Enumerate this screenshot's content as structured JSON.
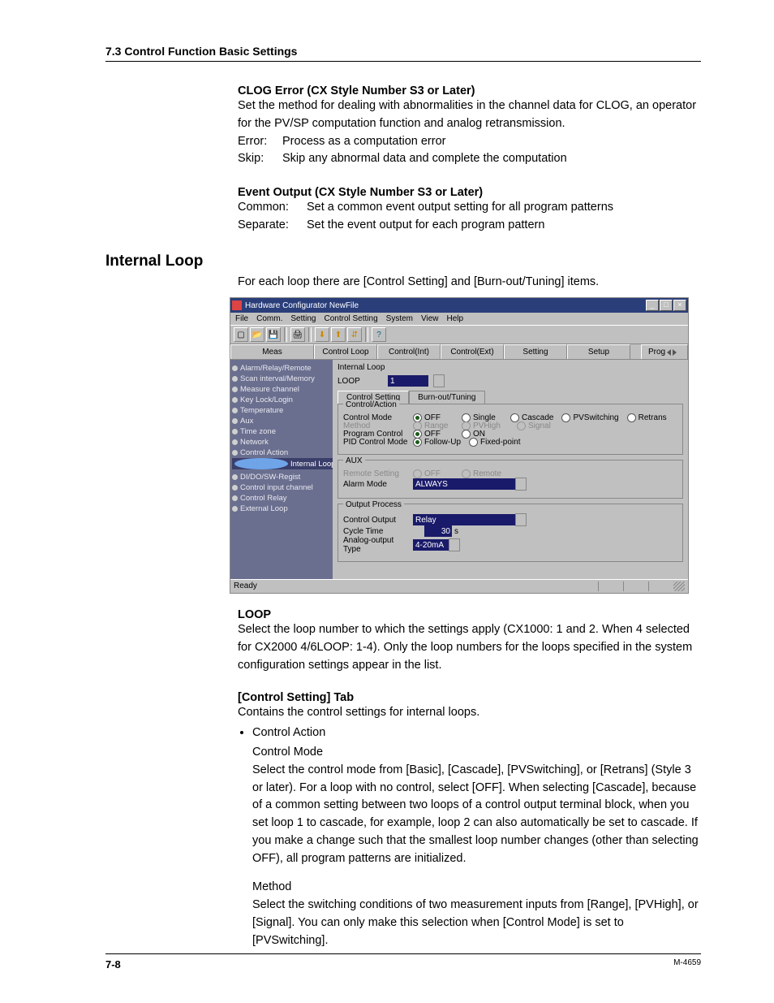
{
  "header": "7.3  Control Function Basic Settings",
  "clog": {
    "heading": "CLOG Error (CX Style Number S3 or Later)",
    "intro": "Set the method for dealing with abnormalities in the channel data for CLOG, an operator for the PV/SP computation function and analog retransmission.",
    "rows": [
      {
        "k": "Error:",
        "v": "Process as a computation error"
      },
      {
        "k": "Skip:",
        "v": "Skip any abnormal data and complete the computation"
      }
    ]
  },
  "event": {
    "heading": "Event Output (CX Style Number S3 or Later)",
    "rows": [
      {
        "k": "Common:",
        "v": "Set a common event output setting for all program patterns"
      },
      {
        "k": "Separate:",
        "v": "Set the event output for each program pattern"
      }
    ]
  },
  "internal_heading": "Internal Loop",
  "internal_intro": "For each loop there are [Control Setting] and [Burn-out/Tuning] items.",
  "shot": {
    "title": "Hardware Configurator NewFile",
    "menus": [
      "File",
      "Comm.",
      "Setting",
      "Control Setting",
      "System",
      "View",
      "Help"
    ],
    "tabs": [
      "Meas",
      "Control Loop",
      "Control(Int)",
      "Control(Ext)",
      "Setting",
      "Setup"
    ],
    "tab_scroll_label": "Prog",
    "tree": [
      "Alarm/Relay/Remote",
      "Scan interval/Memory",
      "Measure channel",
      "Key Lock/Login",
      "Temperature",
      "Aux",
      "Time zone",
      "Network",
      "Control Action",
      "Internal Loop",
      "DI/DO/SW-Regist",
      "Control input channel",
      "Control Relay",
      "External Loop"
    ],
    "tree_selected_index": 9,
    "form_title": "Internal Loop",
    "loop_label": "LOOP",
    "loop_value": "1",
    "subtabs": [
      "Control Setting",
      "Burn-out/Tuning"
    ],
    "group_control": {
      "label": "Control/Action",
      "rows": {
        "control_mode": {
          "label": "Control Mode",
          "opts": [
            "OFF",
            "Single",
            "Cascade",
            "PVSwitching",
            "Retrans"
          ],
          "sel": 0
        },
        "method": {
          "label": "Method",
          "opts": [
            "Range",
            "PVHigh",
            "Signal"
          ],
          "disabled": true
        },
        "program_control": {
          "label": "Program Control",
          "opts": [
            "OFF",
            "ON"
          ],
          "sel": 0
        },
        "pid_mode": {
          "label": "PID Control Mode",
          "opts": [
            "Follow-Up",
            "Fixed-point"
          ],
          "sel": 0
        }
      }
    },
    "group_aux": {
      "label": "AUX",
      "remote": {
        "label": "Remote Setting",
        "opts": [
          "OFF",
          "Remote"
        ],
        "disabled": true
      },
      "alarm": {
        "label": "Alarm Mode",
        "value": "ALWAYS"
      }
    },
    "group_out": {
      "label": "Output Process",
      "control_output": {
        "label": "Control Output",
        "value": "Relay"
      },
      "cycle": {
        "label": "Cycle Time",
        "value": "30",
        "unit": "s"
      },
      "analog": {
        "label": "Analog-output Type",
        "value": "4-20mA"
      }
    },
    "status": "Ready"
  },
  "loop": {
    "heading": "LOOP",
    "text": "Select the loop number to which the settings apply (CX1000: 1 and 2. When 4 selected for CX2000 4/6LOOP: 1-4). Only the loop numbers for the loops specified in the system configuration settings appear in the list."
  },
  "cst": {
    "heading": "[Control Setting] Tab",
    "intro": "Contains the control settings for internal loops.",
    "bullet": "Control Action",
    "cm_label": "Control Mode",
    "cm_text": "Select the control mode from [Basic], [Cascade], [PVSwitching], or [Retrans] (Style 3 or later). For a loop with no control, select [OFF]. When selecting [Cascade], because of a common setting between two loops of a control output terminal block, when you set loop 1 to cascade, for example, loop 2 can also automatically be set to cascade. If you make a change such that the smallest loop number changes (other than selecting OFF), all program patterns are initialized.",
    "method_label": "Method",
    "method_text": "Select the switching conditions of two measurement inputs from [Range], [PVHigh], or [Signal].  You can only make this selection when [Control Mode] is set to [PVSwitching]."
  },
  "footer": {
    "left": "7-8",
    "right": "M-4659"
  }
}
